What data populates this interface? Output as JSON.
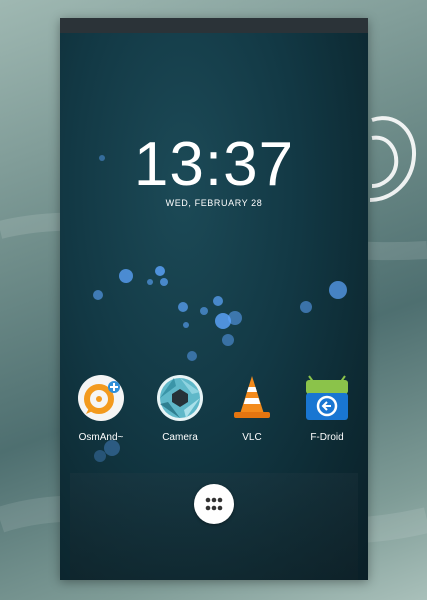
{
  "lockscreen": {
    "time": "13:37",
    "date": "WED, FEBRUARY 28"
  },
  "apps": [
    {
      "label": "OsmAnd~",
      "icon": "osmand-icon"
    },
    {
      "label": "Camera",
      "icon": "camera-icon"
    },
    {
      "label": "VLC",
      "icon": "vlc-icon"
    },
    {
      "label": "F-Droid",
      "icon": "fdroid-icon"
    }
  ],
  "dock": {
    "app_drawer_icon": "app-drawer-icon"
  },
  "colors": {
    "accent_orange": "#f39a1e",
    "fdroid_blue": "#1976d2",
    "fdroid_green": "#8bc34a"
  }
}
